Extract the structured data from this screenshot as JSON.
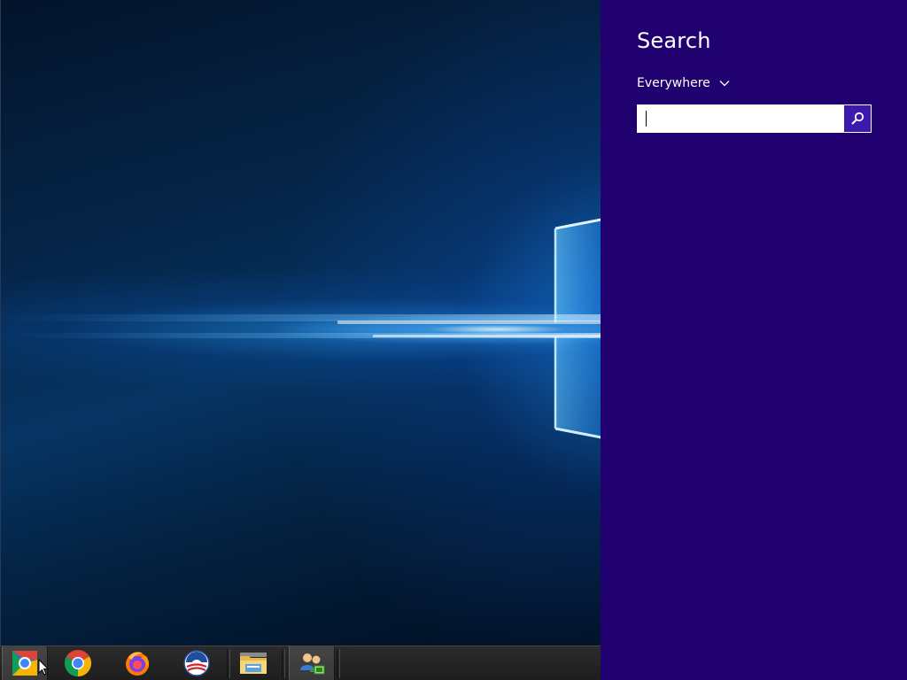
{
  "charm": {
    "title": "Search",
    "scope_label": "Everywhere",
    "search_value": "",
    "search_placeholder": "",
    "background_color": "#210070",
    "button_color": "#3c1ab0"
  },
  "taskbar": {
    "items": [
      {
        "name": "chrome-app-launcher-icon",
        "active": true
      },
      {
        "name": "chrome-icon",
        "active": false
      },
      {
        "name": "firefox-icon",
        "active": false
      },
      {
        "name": "campaign-logo-icon",
        "active": false
      },
      {
        "name": "file-explorer-icon",
        "active": false
      },
      {
        "name": "network-users-icon",
        "active": false
      }
    ]
  },
  "desktop": {
    "wallpaper": "windows-10-hero-light"
  }
}
